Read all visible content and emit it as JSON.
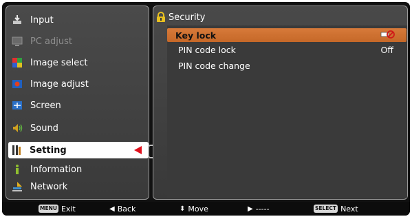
{
  "menu": {
    "items": [
      {
        "label": "Input",
        "icon": "input-icon",
        "disabled": false
      },
      {
        "label": "PC adjust",
        "icon": "pc-adjust-icon",
        "disabled": true
      },
      {
        "label": "Image select",
        "icon": "image-select-icon",
        "disabled": false
      },
      {
        "label": "Image adjust",
        "icon": "image-adjust-icon",
        "disabled": false
      },
      {
        "label": "Screen",
        "icon": "screen-icon",
        "disabled": false
      },
      {
        "label": "Sound",
        "icon": "sound-icon",
        "disabled": false
      },
      {
        "label": "Setting",
        "icon": "setting-icon",
        "disabled": false,
        "selected": true
      },
      {
        "label": "Information",
        "icon": "information-icon",
        "disabled": false
      },
      {
        "label": "Network",
        "icon": "network-icon",
        "disabled": false
      }
    ]
  },
  "submenu": {
    "title": "Security",
    "title_icon": "lock-icon",
    "rows": [
      {
        "label": "Key lock",
        "value_icon": "key-lock-off-icon",
        "selected": true
      },
      {
        "label": "PIN code lock",
        "value": "Off"
      },
      {
        "label": "PIN code change",
        "value": ""
      }
    ]
  },
  "footer": {
    "exit_key": "MENU",
    "exit_label": "Exit",
    "back_label": "Back",
    "move_label": "Move",
    "right_label": "-----",
    "next_key": "SELECT",
    "next_label": "Next"
  },
  "colors": {
    "highlight_orange": "#cf7130",
    "selection_arrow": "#e0101c",
    "panel_background": "#424242"
  }
}
